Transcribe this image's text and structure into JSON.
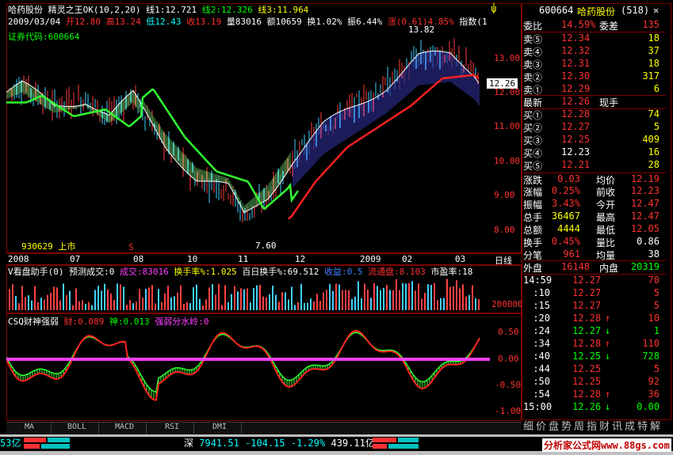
{
  "header": {
    "stock_name": "哈药股份",
    "indicator_name": "精灵之王OK(10,2,20)",
    "line1": "线1:12.721",
    "line2": "线2:12.326",
    "line3": "线3:11.964",
    "date": "2009/03/04",
    "open": "开12.80",
    "high": "高13.24",
    "low": "低12.43",
    "close": "收13.19",
    "volume": "量83016",
    "amount": "额10659",
    "turnover": "换1.02%",
    "amplitude": "振6.44%",
    "change": "涨(0.61)4.85%",
    "index_label": "指数(1",
    "code_label": "证券代码:600664"
  },
  "main_chart": {
    "price_ticks": [
      "13.00",
      "12.00",
      "11.00",
      "10.00",
      "9.00",
      "8.00"
    ],
    "high_marker": "13.82",
    "low_marker": "7.60",
    "current_price": "12.26",
    "listing_label": "930629 上市",
    "s_marker": "S",
    "date_ticks": [
      "2008",
      "07",
      "08",
      "10",
      "11",
      "12",
      "2009",
      "02",
      "03"
    ],
    "period": "日线"
  },
  "volume_panel": {
    "title": "V看盘助手(0)",
    "predict": "预测成交:0",
    "volume": "成交:83016",
    "turnover_rate": "换手率%:1.025",
    "hundred_day": "百日换手%:69.512",
    "shares": "收益:0.5",
    "float": "流通盘:8.103",
    "pe": "市盈率:18",
    "tick": "200000"
  },
  "indicator_panel": {
    "title": "CSQ财神强弱",
    "cai": "财:0.089",
    "shen": "神:0.013",
    "strength": "强弱分水岭:0",
    "ticks": [
      "0.50",
      "0.00",
      "-0.50",
      "-1.00"
    ]
  },
  "bottom_tabs": [
    "MA",
    "BOLL",
    "MACD",
    "RSI",
    "DMI"
  ],
  "status_bar": {
    "left_amount": "53亿",
    "market": "深",
    "index_value": "7941.51",
    "index_change": "-104.15",
    "index_pct": "-1.29%",
    "index_amount": "439.11亿",
    "watermark": "分析家公式网www.88gs.com"
  },
  "quote": {
    "code": "600664",
    "name": "哈药股份",
    "count": "(518)",
    "weibi_label": "委比",
    "weibi": "14.59%",
    "weicha_label": "委差",
    "weicha": "135",
    "asks": [
      {
        "label": "卖⑤",
        "price": "12.34",
        "vol": "18"
      },
      {
        "label": "卖④",
        "price": "12.32",
        "vol": "37"
      },
      {
        "label": "卖③",
        "price": "12.31",
        "vol": "18"
      },
      {
        "label": "卖②",
        "price": "12.30",
        "vol": "317"
      },
      {
        "label": "卖①",
        "price": "12.29",
        "vol": "6"
      }
    ],
    "latest_label": "最新",
    "latest": "12.26",
    "xianshou_label": "现手",
    "bids": [
      {
        "label": "买①",
        "price": "12.28",
        "vol": "74"
      },
      {
        "label": "买②",
        "price": "12.27",
        "vol": "5"
      },
      {
        "label": "买③",
        "price": "12.25",
        "vol": "409"
      },
      {
        "label": "买④",
        "price": "12.23",
        "vol": "16"
      },
      {
        "label": "买⑤",
        "price": "12.21",
        "vol": "28"
      }
    ],
    "stats": [
      {
        "l1": "涨跌",
        "v1": "0.03",
        "l2": "均价",
        "v2": "12.19"
      },
      {
        "l1": "涨幅",
        "v1": "0.25%",
        "l2": "前收",
        "v2": "12.23"
      },
      {
        "l1": "振幅",
        "v1": "3.43%",
        "l2": "今开",
        "v2": "12.47"
      },
      {
        "l1": "总手",
        "v1": "36467",
        "l2": "最高",
        "v2": "12.47"
      },
      {
        "l1": "总额",
        "v1": "4444",
        "l2": "最低",
        "v2": "12.05"
      },
      {
        "l1": "换手",
        "v1": "0.45%",
        "l2": "量比",
        "v2": "0.86"
      },
      {
        "l1": "分笔",
        "v1": "961",
        "l2": "均量",
        "v2": "38"
      }
    ],
    "waipan_label": "外盘",
    "waipan": "16148",
    "neipan_label": "内盘",
    "neipan": "20319",
    "ticks": [
      {
        "t": "14:59",
        "p": "12.27",
        "a": "",
        "v": "70"
      },
      {
        "t": ":10",
        "p": "12.27",
        "a": "",
        "v": "5"
      },
      {
        "t": ":15",
        "p": "12.27",
        "a": "",
        "v": "5"
      },
      {
        "t": ":20",
        "p": "12.28",
        "a": "↑",
        "v": "10"
      },
      {
        "t": ":24",
        "p": "12.27",
        "a": "↓",
        "v": "1"
      },
      {
        "t": ":34",
        "p": "12.28",
        "a": "↑",
        "v": "110"
      },
      {
        "t": ":40",
        "p": "12.25",
        "a": "↓",
        "v": "728"
      },
      {
        "t": ":44",
        "p": "12.25",
        "a": "",
        "v": "5"
      },
      {
        "t": ":50",
        "p": "12.25",
        "a": "",
        "v": "92"
      },
      {
        "t": ":54",
        "p": "12.28",
        "a": "↑",
        "v": "36"
      },
      {
        "t": "15:00",
        "p": "12.26",
        "a": "↓",
        "v": "0.00"
      }
    ],
    "right_tabs": [
      "细",
      "价",
      "盘",
      "势",
      "周",
      "指",
      "财",
      "讯",
      "成",
      "特",
      "解"
    ]
  }
}
